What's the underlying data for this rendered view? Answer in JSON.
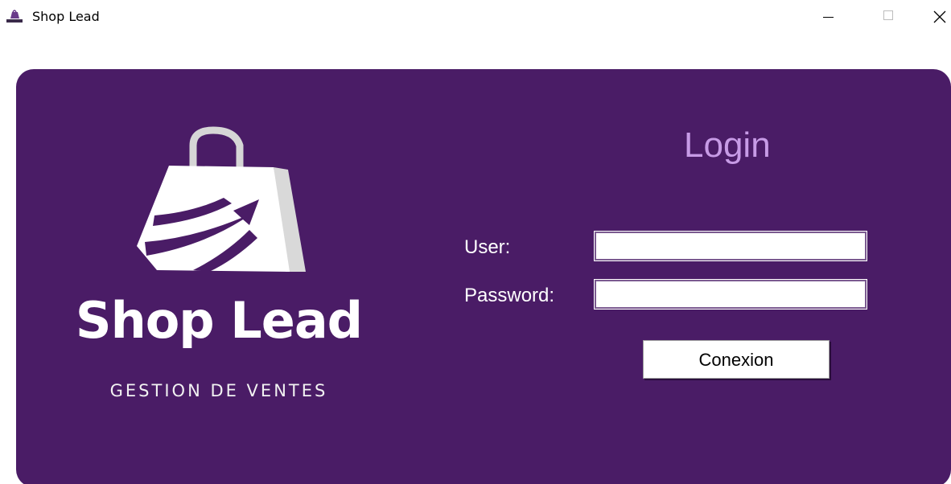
{
  "window": {
    "title": "Shop Lead",
    "icon": "shopping-bag-icon",
    "controls": {
      "minimize": "minimize-icon",
      "maximize": "maximize-icon",
      "close": "close-icon"
    }
  },
  "branding": {
    "name": "Shop Lead",
    "subtitle": "GESTION DE VENTES",
    "logo_icon": "shopping-bag-arrow-icon"
  },
  "login": {
    "title": "Login",
    "user_label": "User:",
    "user_value": "",
    "password_label": "Password:",
    "password_value": "",
    "submit_label": "Conexion"
  },
  "colors": {
    "panel": "#4a1c66",
    "title_accent": "#c79be6",
    "text": "#ffffff"
  }
}
